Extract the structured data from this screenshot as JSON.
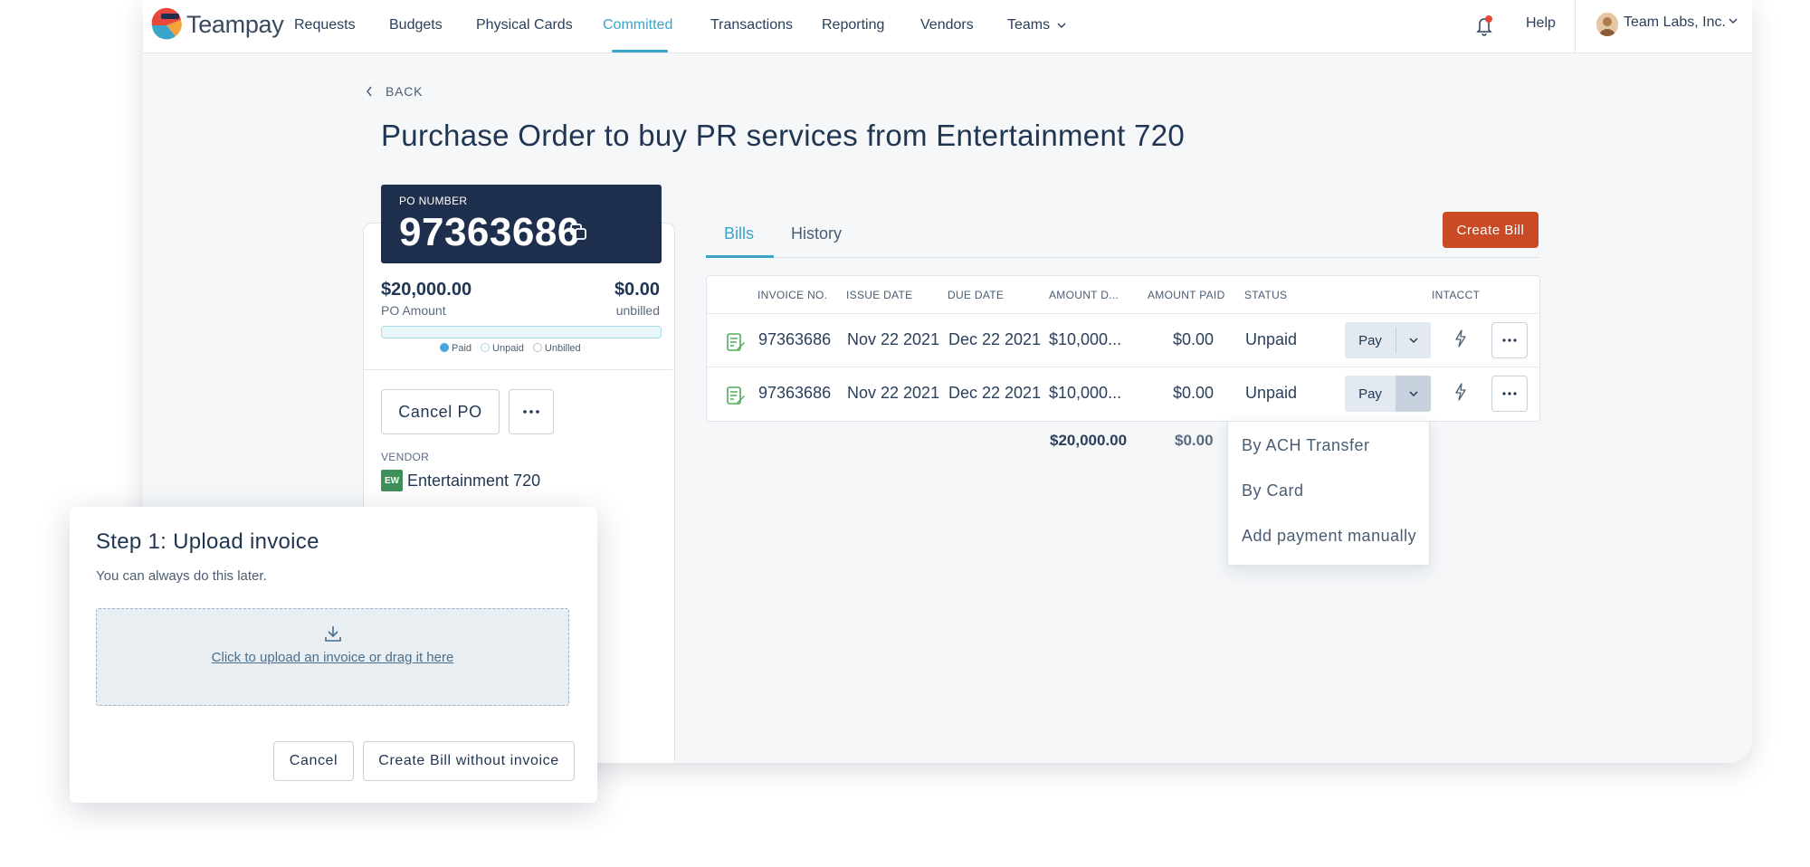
{
  "brand": {
    "name": "Teampay"
  },
  "nav": {
    "items": [
      {
        "label": "Requests"
      },
      {
        "label": "Budgets"
      },
      {
        "label": "Physical Cards"
      },
      {
        "label": "Committed"
      },
      {
        "label": "Transactions"
      },
      {
        "label": "Reporting"
      },
      {
        "label": "Vendors"
      },
      {
        "label": "Teams"
      }
    ],
    "active": "Committed",
    "help": "Help",
    "org": "Team Labs, Inc."
  },
  "page": {
    "back": "BACK",
    "title": "Purchase Order to buy PR services from Entertainment 720"
  },
  "po": {
    "number_label": "PO NUMBER",
    "number": "97363686",
    "amount": "$20,000.00",
    "amount_label": "PO Amount",
    "unbilled": "$0.00",
    "unbilled_label": "unbilled",
    "progress_paid_fraction": 0,
    "legend": {
      "paid": "Paid",
      "unpaid": "Unpaid",
      "unbilled": "Unbilled"
    },
    "cancel_label": "Cancel PO",
    "vendor_label": "VENDOR",
    "vendor_initials": "EW",
    "vendor_name": "Entertainment 720"
  },
  "tabs": [
    {
      "label": "Bills"
    },
    {
      "label": "History"
    }
  ],
  "create_bill": "Create Bill",
  "table": {
    "headers": [
      "INVOICE NO.",
      "ISSUE DATE",
      "DUE DATE",
      "AMOUNT D...",
      "AMOUNT PAID",
      "STATUS",
      "INTACCT"
    ],
    "rows": [
      {
        "invoice": "97363686",
        "issue": "Nov 22 2021",
        "due": "Dec 22 2021",
        "amount_due": "$10,000...",
        "amount_paid": "$0.00",
        "status": "Unpaid",
        "pay": "Pay"
      },
      {
        "invoice": "97363686",
        "issue": "Nov 22 2021",
        "due": "Dec 22 2021",
        "amount_due": "$10,000...",
        "amount_paid": "$0.00",
        "status": "Unpaid",
        "pay": "Pay"
      }
    ],
    "totals": {
      "amount_due": "$20,000.00",
      "amount_paid": "$0.00"
    }
  },
  "pay_menu": {
    "items": [
      "By ACH Transfer",
      "By Card",
      "Add payment manually"
    ]
  },
  "modal": {
    "title": "Step 1: Upload invoice",
    "subtitle": "You can always do this later.",
    "dropzone": "Click to upload an invoice or drag it here",
    "cancel": "Cancel",
    "create_without": "Create Bill without invoice"
  },
  "colors": {
    "accent": "#3aa5c8",
    "navy": "#1e2f4d",
    "create_bill": "#c94a24"
  }
}
